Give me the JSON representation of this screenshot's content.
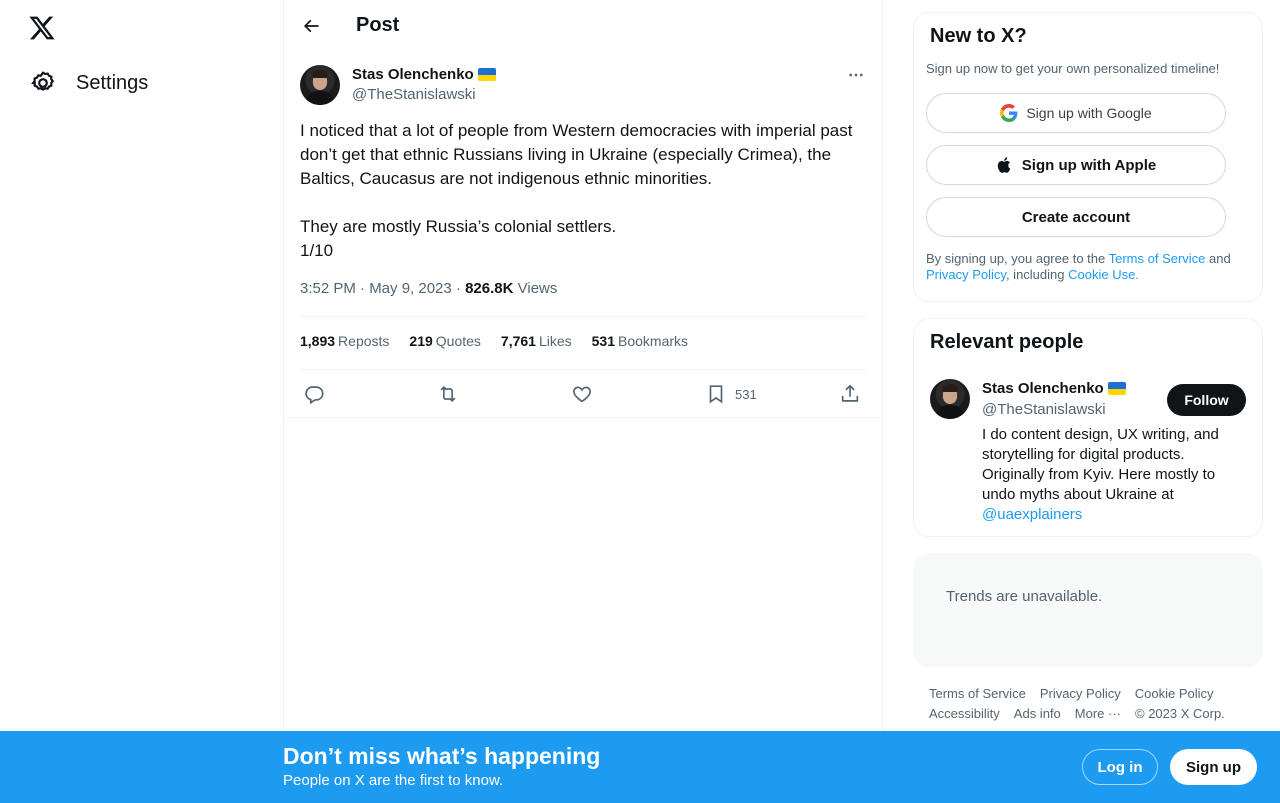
{
  "nav": {
    "logo_icon": "x-logo-icon",
    "settings_label": "Settings"
  },
  "header": {
    "title": "Post"
  },
  "post": {
    "author_name": "Stas Olenchenko",
    "author_handle": "@TheStanislawski",
    "text": "I noticed that a lot of people from Western democracies with imperial past don’t get that ethnic Russians living in Ukraine (especially Crimea), the Baltics, Caucasus are not indigenous ethnic minorities.\n\nThey are mostly Russia’s colonial settlers.\n1/10",
    "timestamp": "3:52 PM · May 9, 2023",
    "separator": " · ",
    "views_count": "826.8K",
    "views_label": "Views",
    "stats": {
      "reposts_count": "1,893",
      "reposts_label": "Reposts",
      "quotes_count": "219",
      "quotes_label": "Quotes",
      "likes_count": "7,761",
      "likes_label": "Likes",
      "bookmarks_count": "531",
      "bookmarks_label": "Bookmarks"
    },
    "bookmark_action_count": "531"
  },
  "signup": {
    "title": "New to X?",
    "subtitle": "Sign up now to get your own personalized timeline!",
    "google_label": "Sign up with Google",
    "apple_label": "Sign up with Apple",
    "create_label": "Create account",
    "legal_prefix": "By signing up, you agree to the ",
    "terms_link": "Terms of Service",
    "legal_and": " and ",
    "privacy_link": "Privacy Policy",
    "legal_including": ", including ",
    "cookie_link": "Cookie Use."
  },
  "people": {
    "title": "Relevant people",
    "name": "Stas Olenchenko",
    "handle": "@TheStanislawski",
    "follow_label": "Follow",
    "bio": "I do content design, UX writing, and storytelling for digital products. Originally from Kyiv. Here mostly to undo myths about Ukraine at",
    "bio_link": "@uaexplainers"
  },
  "trends": {
    "text": "Trends are unavailable."
  },
  "footer": {
    "links": [
      "Terms of Service",
      "Privacy Policy",
      "Cookie Policy",
      "Accessibility",
      "Ads info",
      "More ···",
      "© 2023 X Corp."
    ]
  },
  "banner": {
    "title": "Don’t miss what’s happening",
    "subtitle": "People on X are the first to know.",
    "login_label": "Log in",
    "signup_label": "Sign up"
  },
  "colors": {
    "accent": "#1d9bf0",
    "text_primary": "#0f1419",
    "text_secondary": "#536471"
  }
}
